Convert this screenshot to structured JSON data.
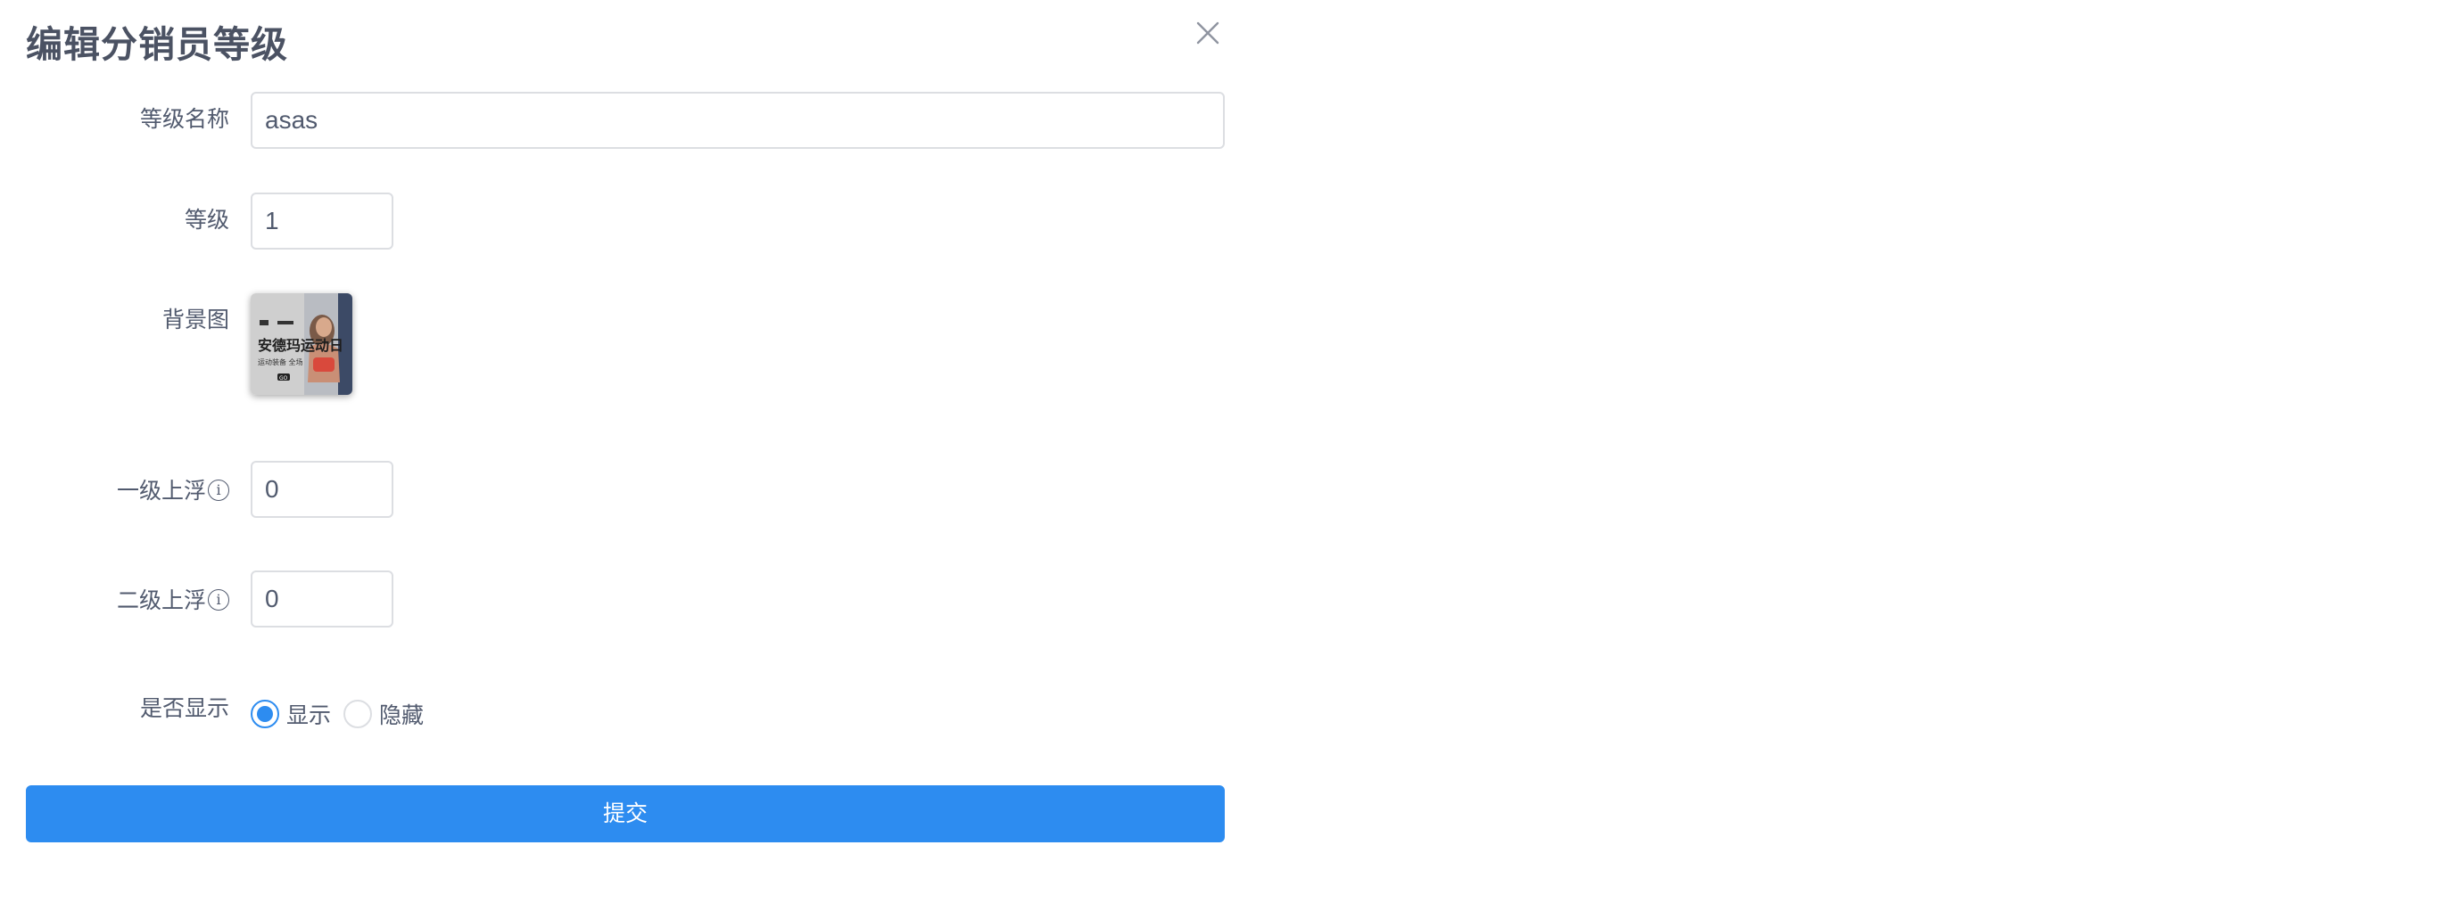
{
  "dialog": {
    "title": "编辑分销员等级"
  },
  "form": {
    "level_name": {
      "label": "等级名称",
      "value": "asas"
    },
    "level": {
      "label": "等级",
      "value": "1"
    },
    "background": {
      "label": "背景图",
      "thumbnail_text": {
        "headline": "安德玛运动日",
        "subline": "运动装备 全场",
        "button": "GO"
      }
    },
    "first_float": {
      "label": "一级上浮",
      "info_icon": "i",
      "value": "0"
    },
    "second_float": {
      "label": "二级上浮",
      "info_icon": "i",
      "value": "0"
    },
    "visibility": {
      "label": "是否显示",
      "options": [
        {
          "label": "显示",
          "checked": true
        },
        {
          "label": "隐藏",
          "checked": false
        }
      ]
    },
    "submit_label": "提交"
  },
  "colors": {
    "accent": "#2d8cf0",
    "text": "#515a6e",
    "border": "#dcdee2"
  },
  "icons": {
    "close": "close-icon",
    "info": "info-icon"
  }
}
